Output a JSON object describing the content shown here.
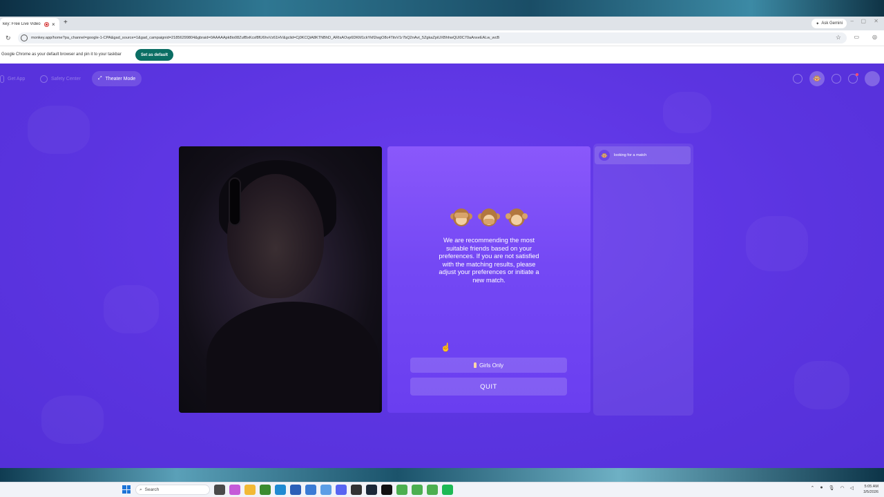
{
  "browser": {
    "tab_title": "key: Free Live Video Ch",
    "tab_close": "×",
    "new_tab": "+",
    "gemini_button": "Ask Gemini",
    "url": "monkey.app/home?pa_channel=google-1-CPA&gad_source=1&gad_campaignid=21856299804&gbraid=0AAAAApk8io08ZufBxKcsf8fU6hvVz61HV&gclid=Cj0KCQiA8KTNBhD_ARIsAOvp6DKM1ckYkfl2wgO8c4TitvV1r7bQ2nAvt_5ZgkaZpiUXBhhwQUl0C70aAnxeEALw_wcB",
    "info_text": "Google Chrome as your default browser and pin it to your taskbar",
    "set_default_label": "Set as default"
  },
  "nav": {
    "get_app": "Get App",
    "safety_center": "Safety Center",
    "theater_mode": "Theater Mode"
  },
  "match": {
    "emoji": [
      "see-no-evil-monkey",
      "speak-no-evil-monkey",
      "hear-no-evil-monkey"
    ],
    "recommend_text": "We are recommending the most suitable friends based on your preferences. If you are not satisfied with the matching results, please adjust your preferences or initiate a new match.",
    "girls_only_label": "Girls Only",
    "quit_label": "QUIT"
  },
  "chat": {
    "status": "looking for a match"
  },
  "taskbar": {
    "search_placeholder": "Search",
    "time": "5:05 AM",
    "date": "3/5/2026"
  },
  "colors": {
    "page_bg": "#5b34e0",
    "panel_top": "#8a58fb",
    "set_default_bg": "#0b6e64"
  }
}
